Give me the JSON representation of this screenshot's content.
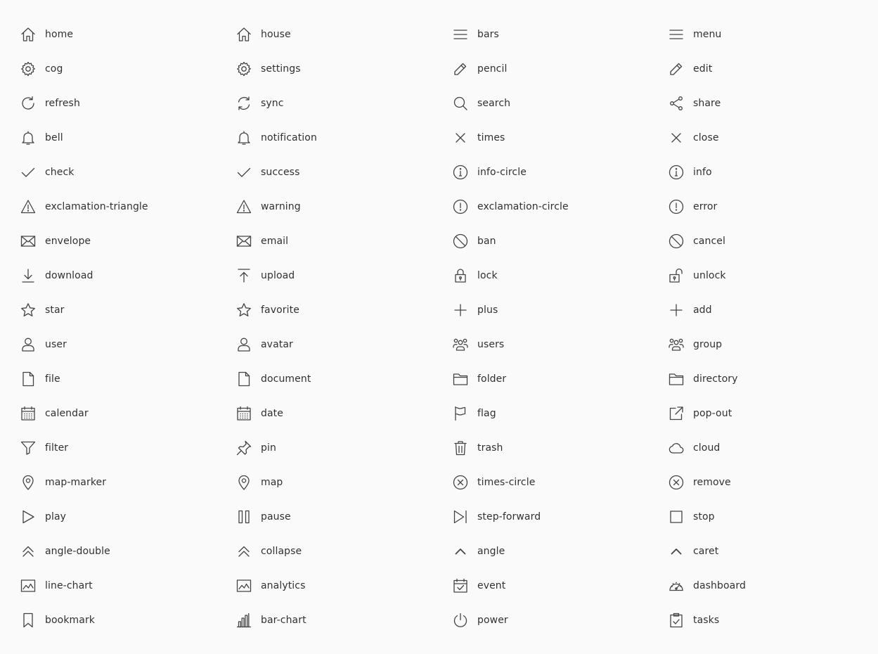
{
  "icons": [
    {
      "label": "home",
      "icon": "home-icon",
      "glyph": "home"
    },
    {
      "label": "house",
      "icon": "house-icon",
      "glyph": "home"
    },
    {
      "label": "bars",
      "icon": "bars-icon",
      "glyph": "bars"
    },
    {
      "label": "menu",
      "icon": "menu-icon",
      "glyph": "bars"
    },
    {
      "label": "cog",
      "icon": "cog-icon",
      "glyph": "cog"
    },
    {
      "label": "settings",
      "icon": "settings-icon",
      "glyph": "cog"
    },
    {
      "label": "pencil",
      "icon": "pencil-icon",
      "glyph": "pencil"
    },
    {
      "label": "edit",
      "icon": "edit-icon",
      "glyph": "pencil"
    },
    {
      "label": "refresh",
      "icon": "refresh-icon",
      "glyph": "refresh"
    },
    {
      "label": "sync",
      "icon": "sync-icon",
      "glyph": "sync"
    },
    {
      "label": "search",
      "icon": "search-icon",
      "glyph": "search"
    },
    {
      "label": "share",
      "icon": "share-icon",
      "glyph": "share"
    },
    {
      "label": "bell",
      "icon": "bell-icon",
      "glyph": "bell"
    },
    {
      "label": "notification",
      "icon": "notification-icon",
      "glyph": "bell"
    },
    {
      "label": "times",
      "icon": "times-icon",
      "glyph": "times"
    },
    {
      "label": "close",
      "icon": "close-icon",
      "glyph": "times"
    },
    {
      "label": "check",
      "icon": "check-icon",
      "glyph": "check"
    },
    {
      "label": "success",
      "icon": "success-icon",
      "glyph": "check"
    },
    {
      "label": "info-circle",
      "icon": "info-circle-icon",
      "glyph": "info"
    },
    {
      "label": "info",
      "icon": "info-icon",
      "glyph": "info"
    },
    {
      "label": "exclamation-triangle",
      "icon": "exclamation-triangle-icon",
      "glyph": "triangle"
    },
    {
      "label": "warning",
      "icon": "warning-icon",
      "glyph": "triangle"
    },
    {
      "label": "exclamation-circle",
      "icon": "exclamation-circle-icon",
      "glyph": "excircle"
    },
    {
      "label": "error",
      "icon": "error-icon",
      "glyph": "excircle"
    },
    {
      "label": "envelope",
      "icon": "envelope-icon",
      "glyph": "envelope"
    },
    {
      "label": "email",
      "icon": "email-icon",
      "glyph": "envelope"
    },
    {
      "label": "ban",
      "icon": "ban-icon",
      "glyph": "ban"
    },
    {
      "label": "cancel",
      "icon": "cancel-icon",
      "glyph": "ban"
    },
    {
      "label": "download",
      "icon": "download-icon",
      "glyph": "download"
    },
    {
      "label": "upload",
      "icon": "upload-icon",
      "glyph": "upload"
    },
    {
      "label": "lock",
      "icon": "lock-icon",
      "glyph": "lock"
    },
    {
      "label": "unlock",
      "icon": "unlock-icon",
      "glyph": "unlock"
    },
    {
      "label": "star",
      "icon": "star-icon",
      "glyph": "star"
    },
    {
      "label": "favorite",
      "icon": "favorite-icon",
      "glyph": "star"
    },
    {
      "label": "plus",
      "icon": "plus-icon",
      "glyph": "plus"
    },
    {
      "label": "add",
      "icon": "add-icon",
      "glyph": "plus"
    },
    {
      "label": "user",
      "icon": "user-icon",
      "glyph": "user"
    },
    {
      "label": "avatar",
      "icon": "avatar-icon",
      "glyph": "user"
    },
    {
      "label": "users",
      "icon": "users-icon",
      "glyph": "users"
    },
    {
      "label": "group",
      "icon": "group-icon",
      "glyph": "users"
    },
    {
      "label": "file",
      "icon": "file-icon",
      "glyph": "file"
    },
    {
      "label": "document",
      "icon": "document-icon",
      "glyph": "file"
    },
    {
      "label": "folder",
      "icon": "folder-icon",
      "glyph": "folder"
    },
    {
      "label": "directory",
      "icon": "directory-icon",
      "glyph": "folder"
    },
    {
      "label": "calendar",
      "icon": "calendar-icon",
      "glyph": "calendar"
    },
    {
      "label": "date",
      "icon": "date-icon",
      "glyph": "calendar"
    },
    {
      "label": "flag",
      "icon": "flag-icon",
      "glyph": "flag"
    },
    {
      "label": "pop-out",
      "icon": "pop-out-icon",
      "glyph": "popout"
    },
    {
      "label": "filter",
      "icon": "filter-icon",
      "glyph": "filter"
    },
    {
      "label": "pin",
      "icon": "pin-icon",
      "glyph": "pin"
    },
    {
      "label": "trash",
      "icon": "trash-icon",
      "glyph": "trash"
    },
    {
      "label": "cloud",
      "icon": "cloud-icon",
      "glyph": "cloud"
    },
    {
      "label": "map-marker",
      "icon": "map-marker-icon",
      "glyph": "marker"
    },
    {
      "label": "map",
      "icon": "map-icon",
      "glyph": "marker"
    },
    {
      "label": "times-circle",
      "icon": "times-circle-icon",
      "glyph": "timescircle"
    },
    {
      "label": "remove",
      "icon": "remove-icon",
      "glyph": "timescircle"
    },
    {
      "label": "play",
      "icon": "play-icon",
      "glyph": "play"
    },
    {
      "label": "pause",
      "icon": "pause-icon",
      "glyph": "pause"
    },
    {
      "label": "step-forward",
      "icon": "step-forward-icon",
      "glyph": "stepforward"
    },
    {
      "label": "stop",
      "icon": "stop-icon",
      "glyph": "stop"
    },
    {
      "label": "angle-double",
      "icon": "angle-double-icon",
      "glyph": "angledouble"
    },
    {
      "label": "collapse",
      "icon": "collapse-icon",
      "glyph": "angledouble"
    },
    {
      "label": "angle",
      "icon": "angle-icon",
      "glyph": "angle"
    },
    {
      "label": "caret",
      "icon": "caret-icon",
      "glyph": "angle"
    },
    {
      "label": "line-chart",
      "icon": "line-chart-icon",
      "glyph": "linechart"
    },
    {
      "label": "analytics",
      "icon": "analytics-icon",
      "glyph": "linechart"
    },
    {
      "label": "event",
      "icon": "event-icon",
      "glyph": "event"
    },
    {
      "label": "dashboard",
      "icon": "dashboard-icon",
      "glyph": "dashboard"
    },
    {
      "label": "bookmark",
      "icon": "bookmark-icon",
      "glyph": "bookmark"
    },
    {
      "label": "bar-chart",
      "icon": "bar-chart-icon",
      "glyph": "barchart"
    },
    {
      "label": "power",
      "icon": "power-icon",
      "glyph": "power"
    },
    {
      "label": "tasks",
      "icon": "tasks-icon",
      "glyph": "tasks"
    }
  ],
  "colors": {
    "background": "#fafafa",
    "text": "#313131",
    "icon_stroke": "#444444"
  }
}
